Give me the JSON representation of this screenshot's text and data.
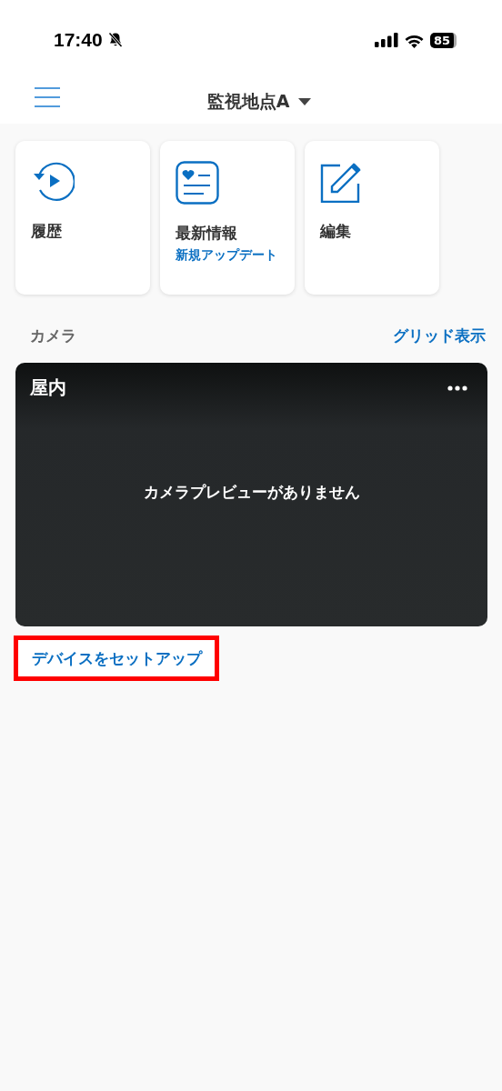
{
  "status_bar": {
    "time": "17:40",
    "battery": "85"
  },
  "header": {
    "title": "監視地点A"
  },
  "tiles": [
    {
      "kind": "history",
      "label": "履歴"
    },
    {
      "kind": "news",
      "label": "最新情報",
      "badge": "新規アップデート"
    },
    {
      "kind": "edit",
      "label": "編集"
    }
  ],
  "camera_section": {
    "title": "カメラ",
    "action": "グリッド表示"
  },
  "cameras": [
    {
      "name": "屋内",
      "message": "カメラプレビューがありません"
    }
  ],
  "setup_link": {
    "label": "デバイスをセットアップ",
    "highlighted": true
  }
}
